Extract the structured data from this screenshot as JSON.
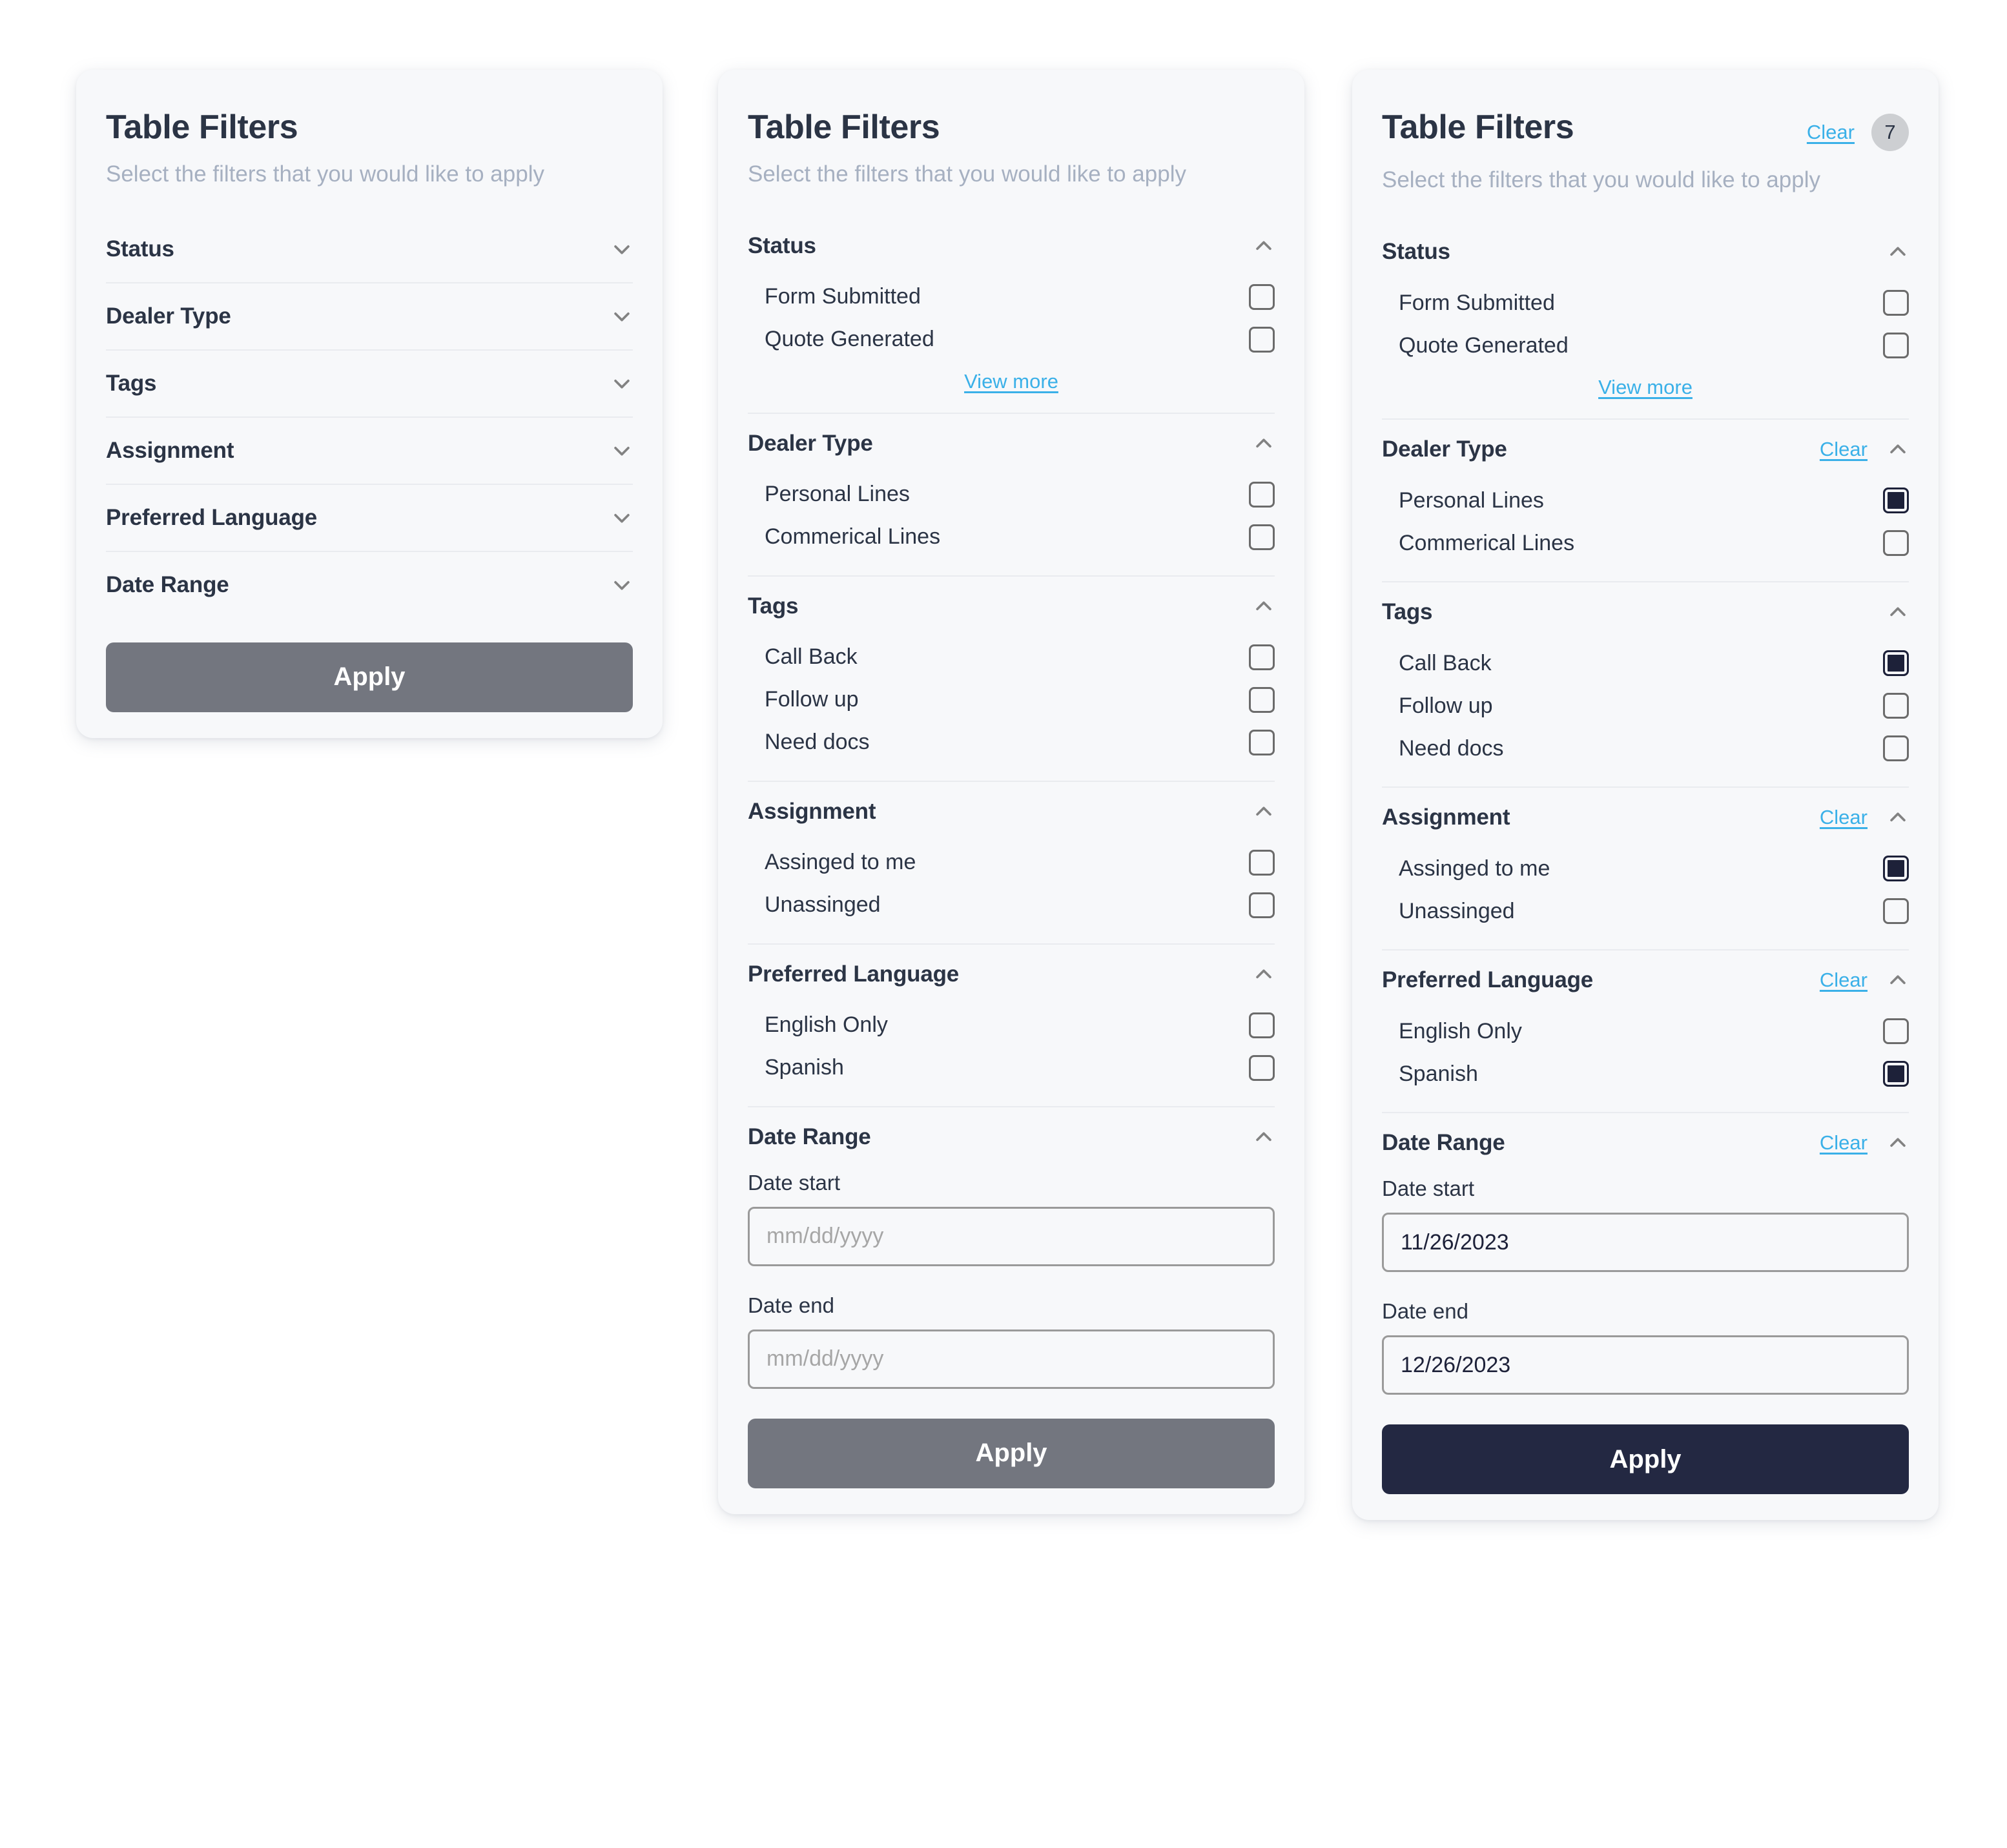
{
  "panels": [
    {
      "title": "Table Filters",
      "subtitle": "Select the filters that you would like to apply",
      "apply_label": "Apply",
      "sections": [
        {
          "title": "Status"
        },
        {
          "title": "Dealer Type"
        },
        {
          "title": "Tags"
        },
        {
          "title": "Assignment"
        },
        {
          "title": "Preferred Language"
        },
        {
          "title": "Date Range"
        }
      ]
    },
    {
      "title": "Table Filters",
      "subtitle": "Select the filters that you would like to apply",
      "apply_label": "Apply",
      "view_more_label": "View more",
      "sections": [
        {
          "title": "Status",
          "options": [
            {
              "label": "Form Submitted",
              "checked": false
            },
            {
              "label": "Quote Generated",
              "checked": false
            }
          ],
          "view_more": "View more"
        },
        {
          "title": "Dealer Type",
          "options": [
            {
              "label": "Personal Lines",
              "checked": false
            },
            {
              "label": "Commerical Lines",
              "checked": false
            }
          ]
        },
        {
          "title": "Tags",
          "options": [
            {
              "label": "Call Back",
              "checked": false
            },
            {
              "label": "Follow up",
              "checked": false
            },
            {
              "label": "Need docs",
              "checked": false
            }
          ]
        },
        {
          "title": "Assignment",
          "options": [
            {
              "label": "Assinged to me",
              "checked": false
            },
            {
              "label": "Unassinged",
              "checked": false
            }
          ]
        },
        {
          "title": "Preferred Language",
          "options": [
            {
              "label": "English Only",
              "checked": false
            },
            {
              "label": "Spanish",
              "checked": false
            }
          ]
        },
        {
          "title": "Date Range",
          "date_start_label": "Date start",
          "date_start_value": "",
          "date_start_placeholder": "mm/dd/yyyy",
          "date_end_label": "Date end",
          "date_end_value": "",
          "date_end_placeholder": "mm/dd/yyyy"
        }
      ]
    },
    {
      "title": "Table Filters",
      "subtitle": "Select the filters that you would like to apply",
      "apply_label": "Apply",
      "clear_label": "Clear",
      "active_filter_count": "7",
      "sections": [
        {
          "title": "Status",
          "clear_label": null,
          "options": [
            {
              "label": "Form Submitted",
              "checked": false
            },
            {
              "label": "Quote Generated",
              "checked": false
            }
          ],
          "view_more": "View more"
        },
        {
          "title": "Dealer Type",
          "clear_label": "Clear",
          "options": [
            {
              "label": "Personal Lines",
              "checked": true
            },
            {
              "label": "Commerical Lines",
              "checked": false
            }
          ]
        },
        {
          "title": "Tags",
          "clear_label": null,
          "options": [
            {
              "label": "Call Back",
              "checked": true
            },
            {
              "label": "Follow up",
              "checked": false
            },
            {
              "label": "Need docs",
              "checked": false
            }
          ]
        },
        {
          "title": "Assignment",
          "clear_label": "Clear",
          "options": [
            {
              "label": "Assinged to me",
              "checked": true
            },
            {
              "label": "Unassinged",
              "checked": false
            }
          ]
        },
        {
          "title": "Preferred Language",
          "clear_label": "Clear",
          "options": [
            {
              "label": "English Only",
              "checked": false
            },
            {
              "label": "Spanish",
              "checked": true
            }
          ]
        },
        {
          "title": "Date Range",
          "clear_label": "Clear",
          "date_start_label": "Date start",
          "date_start_value": "11/26/2023",
          "date_start_placeholder": "mm/dd/yyyy",
          "date_end_label": "Date end",
          "date_end_value": "12/26/2023",
          "date_end_placeholder": "mm/dd/yyyy"
        }
      ]
    }
  ],
  "colors": {
    "card_bg": "#F7F8FA",
    "title": "#2B3445",
    "subtitle": "#A6B0C1",
    "link": "#3AB0E8",
    "checkbox_checked": "#1D2139",
    "apply_disabled": "#73767F",
    "apply_active": "#232842",
    "badge_bg": "#CDCFD2"
  }
}
